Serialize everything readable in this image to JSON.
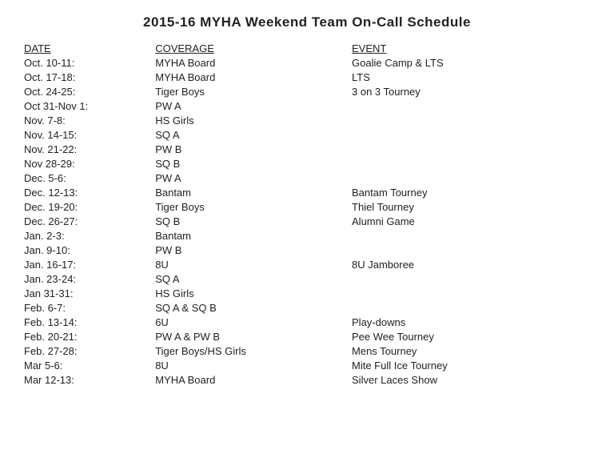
{
  "title": "2015-16   MYHA Weekend Team On-Call Schedule",
  "headers": {
    "date": "DATE",
    "coverage": "COVERAGE",
    "event": "EVENT"
  },
  "rows": [
    {
      "date": "Oct. 10-11:",
      "coverage": "MYHA Board",
      "event": "Goalie Camp & LTS"
    },
    {
      "date": "Oct. 17-18:",
      "coverage": "MYHA Board",
      "event": "LTS"
    },
    {
      "date": "Oct. 24-25:",
      "coverage": "Tiger Boys",
      "event": "3 on 3 Tourney"
    },
    {
      "date": "Oct 31-Nov 1:",
      "coverage": "PW A",
      "event": ""
    },
    {
      "date": "Nov. 7-8:",
      "coverage": "HS Girls",
      "event": ""
    },
    {
      "date": "Nov. 14-15:",
      "coverage": "SQ A",
      "event": ""
    },
    {
      "date": "Nov. 21-22:",
      "coverage": "PW B",
      "event": ""
    },
    {
      "date": "Nov 28-29:",
      "coverage": "SQ B",
      "event": ""
    },
    {
      "date": "Dec. 5-6:",
      "coverage": "PW A",
      "event": ""
    },
    {
      "date": "Dec. 12-13:",
      "coverage": "Bantam",
      "event": "Bantam Tourney"
    },
    {
      "date": "Dec. 19-20:",
      "coverage": "Tiger Boys",
      "event": "Thiel Tourney"
    },
    {
      "date": "Dec. 26-27:",
      "coverage": "SQ B",
      "event": "Alumni Game"
    },
    {
      "date": "Jan. 2-3:",
      "coverage": "Bantam",
      "event": ""
    },
    {
      "date": "Jan. 9-10:",
      "coverage": "PW B",
      "event": ""
    },
    {
      "date": "Jan. 16-17:",
      "coverage": "8U",
      "event": "8U Jamboree"
    },
    {
      "date": "Jan. 23-24:",
      "coverage": "SQ A",
      "event": ""
    },
    {
      "date": "Jan 31-31:",
      "coverage": "HS Girls",
      "event": ""
    },
    {
      "date": "Feb. 6-7:",
      "coverage": "SQ A & SQ B",
      "event": ""
    },
    {
      "date": "Feb. 13-14:",
      "coverage": "6U",
      "event": "Play-downs"
    },
    {
      "date": "Feb. 20-21:",
      "coverage": "PW A & PW B",
      "event": "Pee Wee Tourney"
    },
    {
      "date": "Feb. 27-28:",
      "coverage": "Tiger Boys/HS Girls",
      "event": "Mens Tourney"
    },
    {
      "date": "Mar 5-6:",
      "coverage": "8U",
      "event": "Mite Full Ice Tourney"
    },
    {
      "date": "Mar 12-13:",
      "coverage": "MYHA Board",
      "event": "Silver Laces Show"
    }
  ]
}
